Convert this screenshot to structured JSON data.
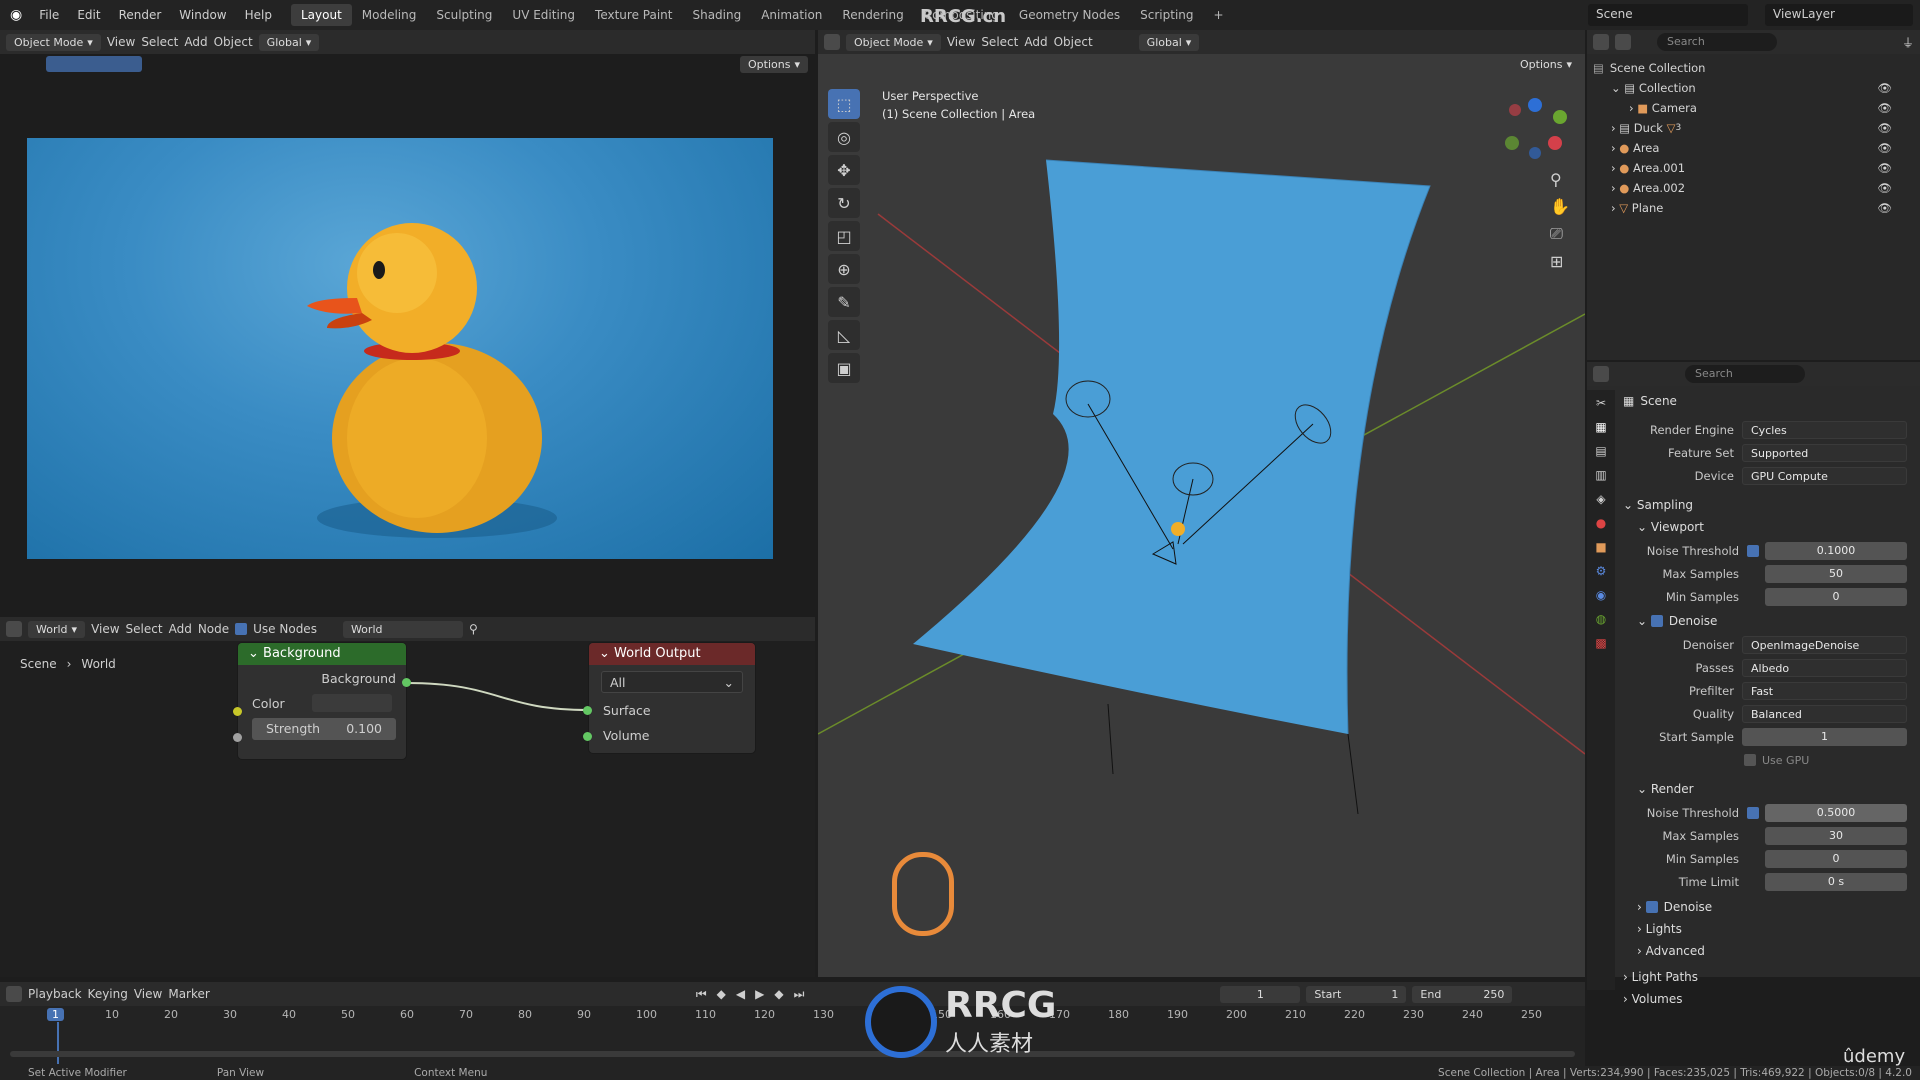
{
  "menu": [
    "File",
    "Edit",
    "Render",
    "Window",
    "Help"
  ],
  "workspaces": [
    "Layout",
    "Modeling",
    "Sculpting",
    "UV Editing",
    "Texture Paint",
    "Shading",
    "Animation",
    "Rendering",
    "Compositing",
    "Geometry Nodes",
    "Scripting"
  ],
  "active_workspace": "Layout",
  "scene_name": "Scene",
  "view_layer": "ViewLayer",
  "left_header": {
    "mode": "Object Mode",
    "view": "View",
    "select": "Select",
    "add": "Add",
    "object": "Object",
    "orientation": "Global",
    "options": "Options"
  },
  "node_editor": {
    "world_type": "World",
    "view": "View",
    "select": "Select",
    "add": "Add",
    "node": "Node",
    "use_nodes": "Use Nodes",
    "world_name": "World",
    "breadcrumb_scene": "Scene",
    "breadcrumb_world": "World",
    "bg_node": {
      "title": "Background",
      "output": "Background",
      "color_label": "Color",
      "strength_label": "Strength",
      "strength_value": "0.100"
    },
    "out_node": {
      "title": "World Output",
      "target": "All",
      "surface": "Surface",
      "volume": "Volume"
    }
  },
  "viewport": {
    "mode": "Object Mode",
    "view": "View",
    "select": "Select",
    "add": "Add",
    "object": "Object",
    "orientation": "Global",
    "options": "Options",
    "overlay_line1": "User Perspective",
    "overlay_line2": "(1) Scene Collection | Area"
  },
  "outliner": {
    "search": "Search",
    "root": "Scene Collection",
    "items": [
      {
        "name": "Collection",
        "indent": 1
      },
      {
        "name": "Camera",
        "indent": 2
      },
      {
        "name": "Duck",
        "indent": 1
      },
      {
        "name": "Area",
        "indent": 1
      },
      {
        "name": "Area.001",
        "indent": 1
      },
      {
        "name": "Area.002",
        "indent": 1
      },
      {
        "name": "Plane",
        "indent": 1
      }
    ],
    "duck_badge": "3"
  },
  "properties": {
    "search": "Search",
    "context": "Scene",
    "render_engine_label": "Render Engine",
    "render_engine": "Cycles",
    "feature_set_label": "Feature Set",
    "feature_set": "Supported",
    "device_label": "Device",
    "device": "GPU Compute",
    "sampling": "Sampling",
    "viewport": "Viewport",
    "vp_noise_label": "Noise Threshold",
    "vp_noise": "0.1000",
    "vp_max_label": "Max Samples",
    "vp_max": "50",
    "vp_min_label": "Min Samples",
    "vp_min": "0",
    "denoise": "Denoise",
    "denoiser_label": "Denoiser",
    "denoiser": "OpenImageDenoise",
    "passes_label": "Passes",
    "passes": "Albedo",
    "prefilter_label": "Prefilter",
    "prefilter": "Fast",
    "quality_label": "Quality",
    "quality": "Balanced",
    "start_label": "Start Sample",
    "start_sample": "1",
    "use_gpu": "Use GPU",
    "render": "Render",
    "r_noise_label": "Noise Threshold",
    "r_noise": "0.5000",
    "r_max_label": "Max Samples",
    "r_max": "30",
    "r_min_label": "Min Samples",
    "r_min": "0",
    "time_label": "Time Limit",
    "time_limit": "0 s",
    "r_denoise": "Denoise",
    "lights": "Lights",
    "advanced": "Advanced",
    "light_paths": "Light Paths",
    "volumes": "Volumes"
  },
  "timeline": {
    "playback": "Playback",
    "keying": "Keying",
    "view": "View",
    "marker": "Marker",
    "current": "1",
    "start_label": "Start",
    "start": "1",
    "end_label": "End",
    "end": "250",
    "ticks": [
      "10",
      "20",
      "30",
      "40",
      "50",
      "60",
      "70",
      "80",
      "90",
      "100",
      "110",
      "120",
      "130",
      "140",
      "150",
      "160",
      "170",
      "180",
      "190",
      "200",
      "210",
      "220",
      "230",
      "240",
      "250"
    ]
  },
  "status": {
    "left1": "Set Active Modifier",
    "left2": "Pan View",
    "left3": "Context Menu",
    "right": "Scene Collection | Area | Verts:234,990 | Faces:235,025 | Tris:469,922 | Objects:0/8 | 4.2.0"
  },
  "watermark": {
    "site": "RRCG.cn",
    "logo_text": "RRCG",
    "logo_sub": "人人素材",
    "udemy": "ûdemy"
  }
}
